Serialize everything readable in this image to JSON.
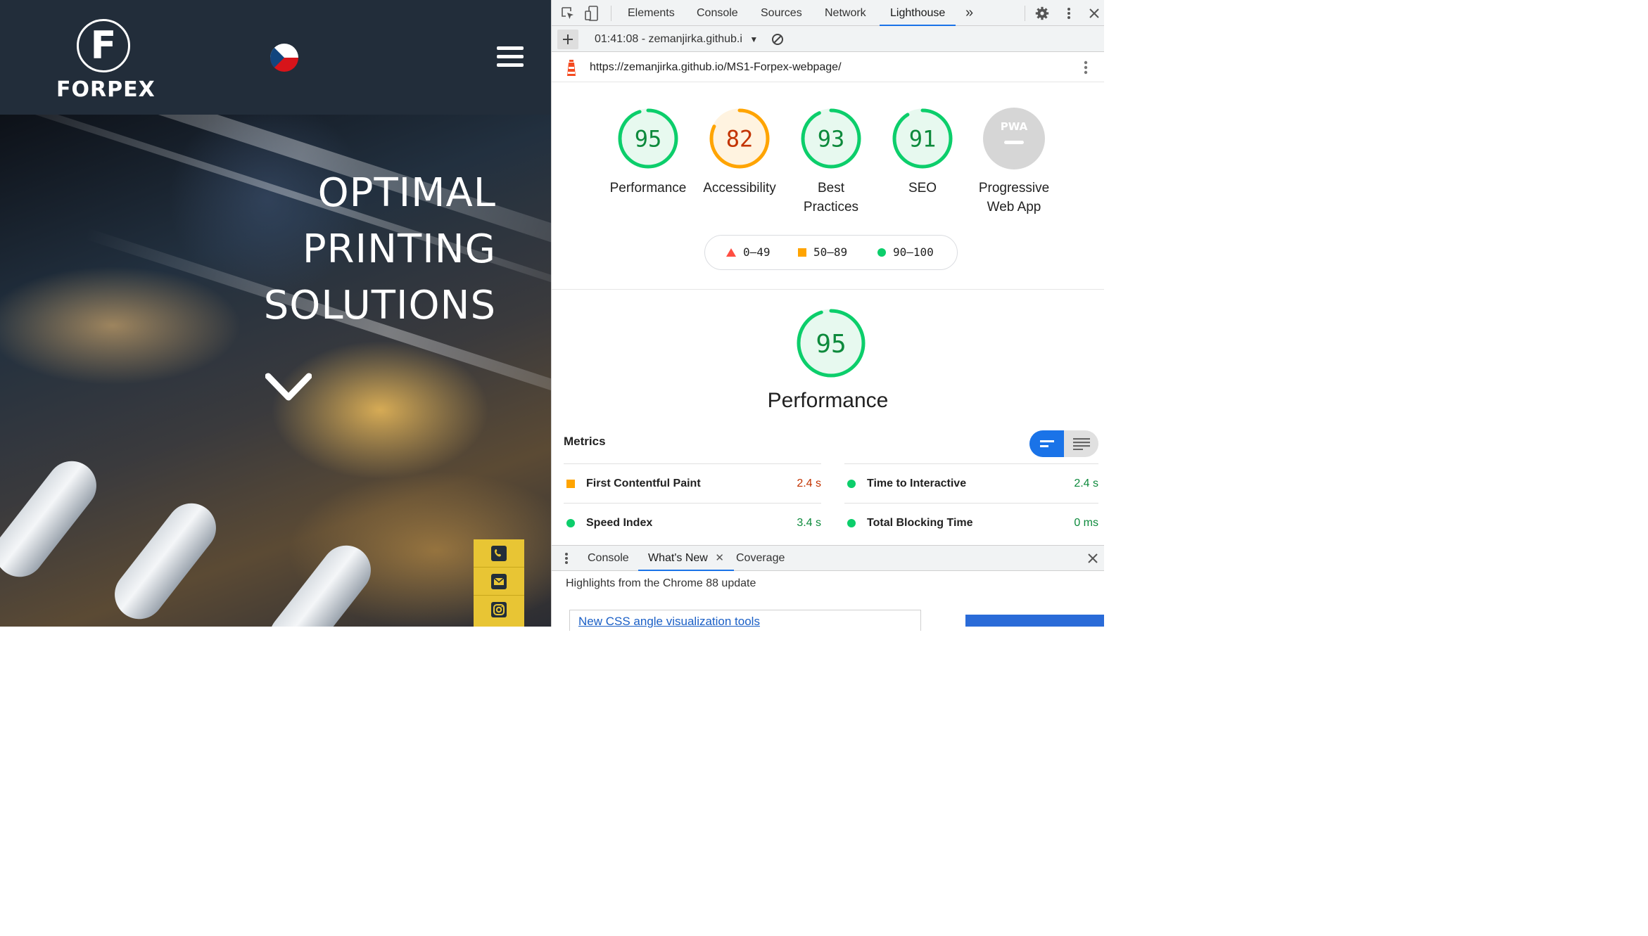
{
  "site": {
    "logo_letter": "F",
    "logo_name": "FORPEX",
    "headline": [
      "OPTIMAL",
      "PRINTING",
      "SOLUTIONS"
    ],
    "language_flag": "czech-flag-icon",
    "contact_icons": [
      "phone-icon",
      "mail-icon",
      "instagram-icon"
    ],
    "colors": {
      "header": "#222d3a",
      "contact_bar": "#e8c534"
    }
  },
  "devtools": {
    "tabs": [
      {
        "label": "Elements"
      },
      {
        "label": "Console"
      },
      {
        "label": "Sources"
      },
      {
        "label": "Network"
      },
      {
        "label": "Lighthouse",
        "active": true
      }
    ],
    "more_tabs": "»",
    "report_selector": "01:41:08 - zemanjirka.github.i",
    "audited_url": "https://zemanjirka.github.io/MS1-Forpex-webpage/"
  },
  "lighthouse": {
    "categories": [
      {
        "label": "Performance",
        "score": 95,
        "status": "pass"
      },
      {
        "label": "Accessibility",
        "score": 82,
        "status": "average"
      },
      {
        "label": "Best Practices",
        "score": 93,
        "status": "pass"
      },
      {
        "label": "SEO",
        "score": 91,
        "status": "pass"
      },
      {
        "label": "Progressive Web App",
        "badge": "PWA",
        "status": "na"
      }
    ],
    "legend": [
      {
        "range": "0–49",
        "shape": "triangle"
      },
      {
        "range": "50–89",
        "shape": "square"
      },
      {
        "range": "90–100",
        "shape": "circle"
      }
    ],
    "section": {
      "score": 95,
      "title": "Performance"
    },
    "metrics_label": "Metrics",
    "metrics": [
      {
        "name": "First Contentful Paint",
        "value": "2.4 s",
        "status": "average"
      },
      {
        "name": "Time to Interactive",
        "value": "2.4 s",
        "status": "pass"
      },
      {
        "name": "Speed Index",
        "value": "3.4 s",
        "status": "pass"
      },
      {
        "name": "Total Blocking Time",
        "value": "0 ms",
        "status": "pass"
      }
    ],
    "colors": {
      "pass": "#0cce6b",
      "pass_text": "#0d8a3c",
      "average": "#ffa400",
      "average_text": "#c33300",
      "fail": "#ff4e42",
      "na": "#d6d6d6"
    }
  },
  "drawer": {
    "tabs": [
      {
        "label": "Console"
      },
      {
        "label": "What's New",
        "active": true
      },
      {
        "label": "Coverage"
      }
    ],
    "highlights": "Highlights from the Chrome 88 update",
    "news_link": "New CSS angle visualization tools"
  }
}
